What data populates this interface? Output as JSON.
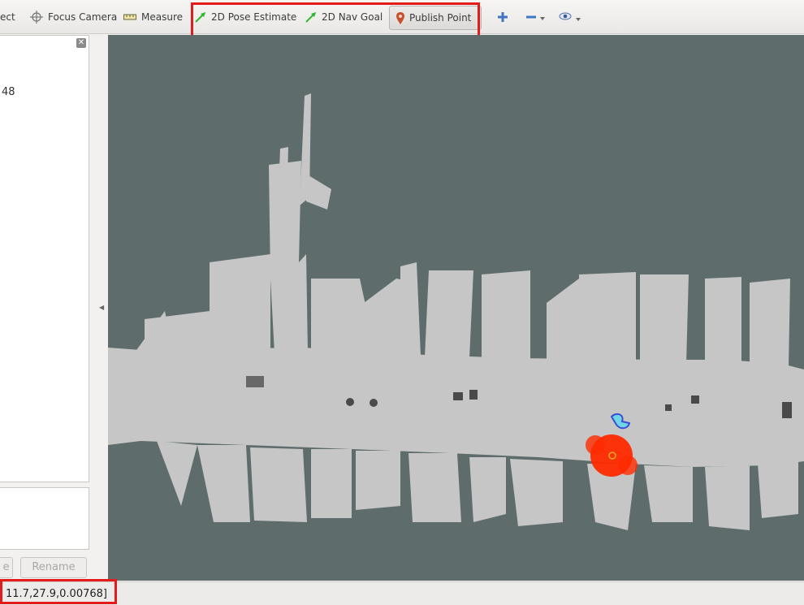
{
  "toolbar": {
    "items": [
      {
        "label": "ect",
        "icon": "interact-icon"
      },
      {
        "label": "Focus Camera",
        "icon": "crosshair-icon"
      },
      {
        "label": "Measure",
        "icon": "ruler-icon"
      },
      {
        "label": "2D Pose Estimate",
        "icon": "green-arrow-icon"
      },
      {
        "label": "2D Nav Goal",
        "icon": "green-arrow-icon"
      },
      {
        "label": "Publish Point",
        "icon": "map-pin-icon"
      }
    ],
    "add_icon": "plus-icon",
    "remove_icon": "minus-icon",
    "view_icon": "eye-icon"
  },
  "left_panel": {
    "value_text": "48",
    "buttons": {
      "partial_label": "e",
      "rename_label": "Rename"
    }
  },
  "status": {
    "coordinates": "11.7,27.9,0.00768]"
  },
  "colors": {
    "highlight": "#e31b1b",
    "map_background": "#5e6d6c",
    "free_space": "#c6c6c6",
    "particle_cloud": "#ff2a00",
    "robot_footprint": "#3a4fd6"
  }
}
